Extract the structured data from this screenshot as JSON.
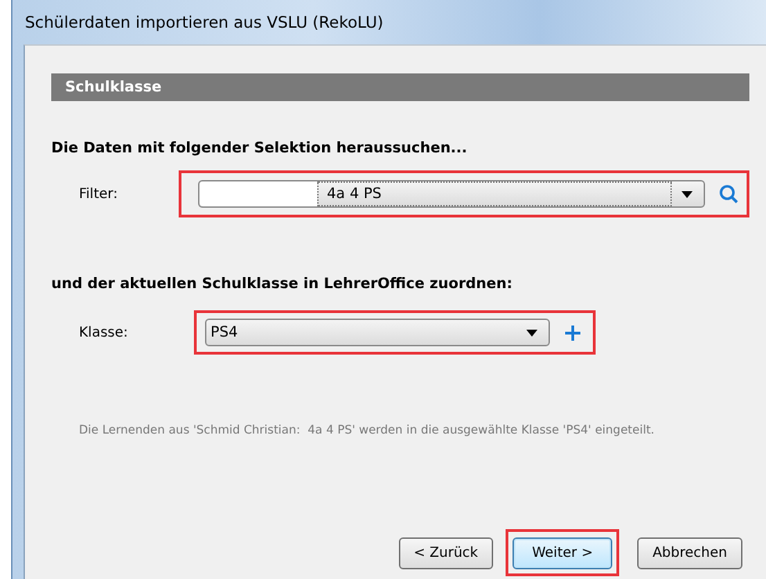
{
  "window": {
    "title": "Schülerdaten importieren aus VSLU (RekoLU)"
  },
  "section": {
    "title": "Schulklasse"
  },
  "filter_heading": "Die Daten mit folgender Selektion heraussuchen...",
  "filter": {
    "label": "Filter:",
    "value": "4a 4 PS",
    "highlighted": true
  },
  "class_heading": "und der aktuellen Schulklasse in LehrerOffice zuordnen:",
  "klasse": {
    "label": "Klasse:",
    "value": "PS4",
    "highlighted": true
  },
  "info": "Die Lernenden aus 'Schmid Christian:  4a 4 PS' werden in die ausgewählte Klasse 'PS4' eingeteilt.",
  "buttons": [
    {
      "label": "< Zurück",
      "default": false,
      "highlighted": false
    },
    {
      "label": "Weiter >",
      "default": true,
      "highlighted": true
    },
    {
      "label": "Abbrechen",
      "default": false,
      "highlighted": false
    }
  ]
}
